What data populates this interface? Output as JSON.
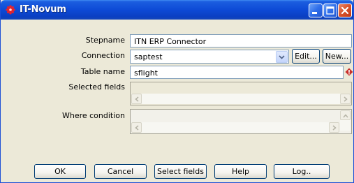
{
  "window": {
    "title": "IT-Novum",
    "title_bar_color": "#0a3fc2",
    "icon": "app-icon",
    "controls": [
      "minimize-icon",
      "maximize-icon",
      "close-icon"
    ]
  },
  "form": {
    "stepname": {
      "label": "Stepname",
      "value": "ITN ERP Connector"
    },
    "connection": {
      "label": "Connection",
      "value": "saptest",
      "edit_label": "Edit...",
      "new_label": "New..."
    },
    "table_name": {
      "label": "Table name",
      "value": "sflight",
      "indicator_icon": "variable-diamond-icon"
    },
    "selected_fields": {
      "label": "Selected fields"
    },
    "where_condition": {
      "label": "Where condition"
    }
  },
  "buttons": {
    "ok": "OK",
    "cancel": "Cancel",
    "select_fields": "Select fields",
    "help": "Help",
    "log": "Log.."
  }
}
